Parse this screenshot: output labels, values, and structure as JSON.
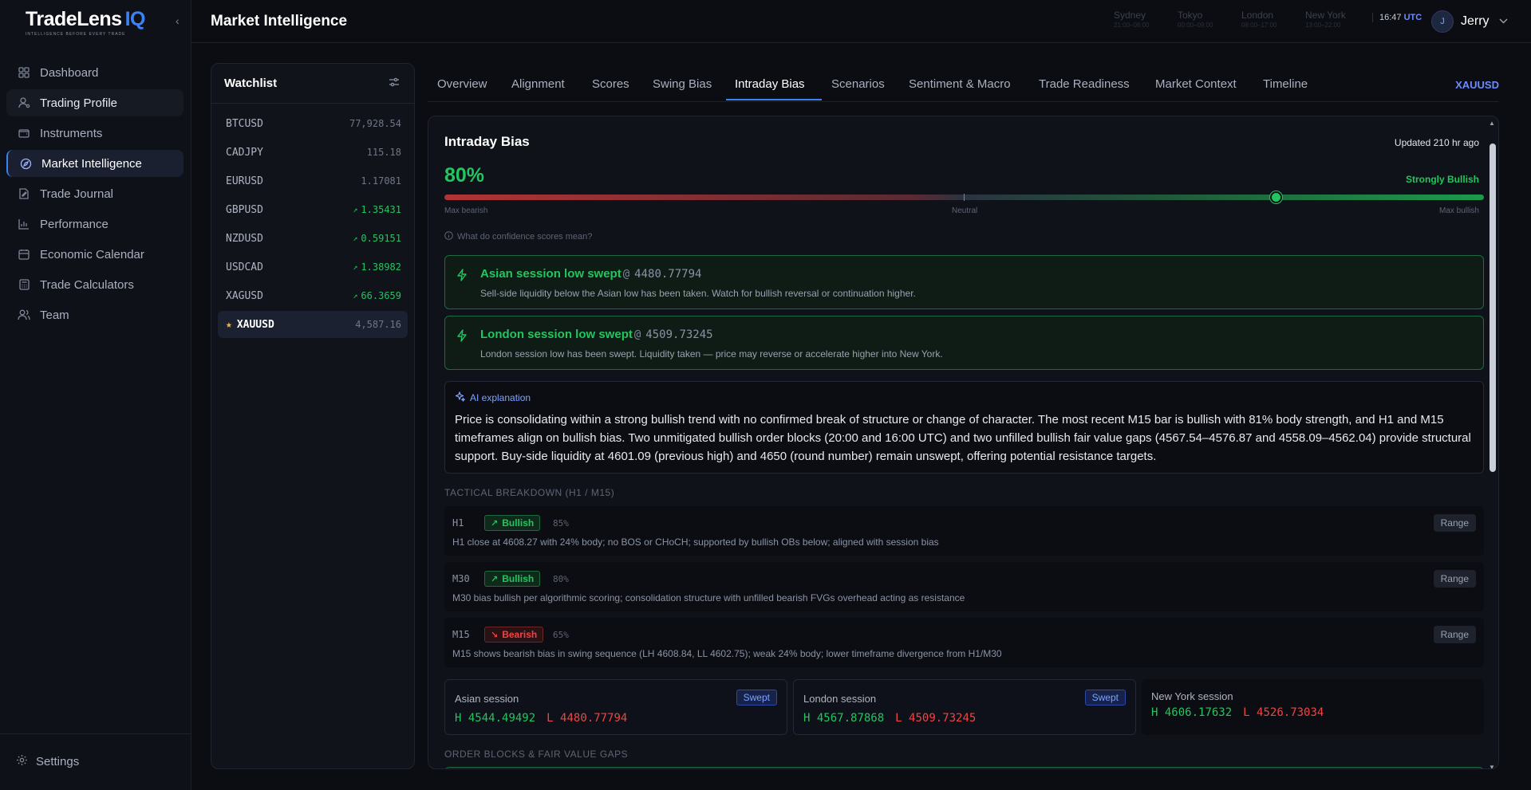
{
  "brand": {
    "name": "TradeLens",
    "suffix": "IQ",
    "tagline": "INTELLIGENCE BEFORE EVERY TRADE"
  },
  "sidebar": {
    "items": [
      {
        "label": "Dashboard",
        "icon": "grid-icon"
      },
      {
        "label": "Trading Profile",
        "icon": "user-settings-icon"
      },
      {
        "label": "Instruments",
        "icon": "wallet-icon"
      },
      {
        "label": "Market Intelligence",
        "icon": "compass-icon"
      },
      {
        "label": "Trade Journal",
        "icon": "journal-icon"
      },
      {
        "label": "Performance",
        "icon": "bar-chart-icon"
      },
      {
        "label": "Economic Calendar",
        "icon": "calendar-icon"
      },
      {
        "label": "Trade Calculators",
        "icon": "calculator-icon"
      },
      {
        "label": "Team",
        "icon": "team-icon"
      }
    ],
    "settings_label": "Settings"
  },
  "header": {
    "title": "Market Intelligence",
    "sessions": [
      {
        "name": "Sydney",
        "hours": "21:00–06:00"
      },
      {
        "name": "Tokyo",
        "hours": "00:00–09:00"
      },
      {
        "name": "London",
        "hours": "08:00–17:00"
      },
      {
        "name": "New York",
        "hours": "13:00–22:00"
      }
    ],
    "clock": {
      "time": "16:47",
      "zone": "UTC"
    },
    "user": {
      "initial": "J",
      "name": "Jerry"
    }
  },
  "watchlist": {
    "title": "Watchlist",
    "items": [
      {
        "symbol": "BTCUSD",
        "price": "77,928.54",
        "trend": ""
      },
      {
        "symbol": "CADJPY",
        "price": "115.18",
        "trend": ""
      },
      {
        "symbol": "EURUSD",
        "price": "1.17081",
        "trend": ""
      },
      {
        "symbol": "GBPUSD",
        "price": "1.35431",
        "trend": "up"
      },
      {
        "symbol": "NZDUSD",
        "price": "0.59151",
        "trend": "up"
      },
      {
        "symbol": "USDCAD",
        "price": "1.38982",
        "trend": "up"
      },
      {
        "symbol": "XAGUSD",
        "price": "66.3659",
        "trend": "up"
      },
      {
        "symbol": "XAUUSD",
        "price": "4,587.16",
        "trend": "",
        "selected": true
      }
    ]
  },
  "tabs": {
    "items": [
      "Overview",
      "Alignment",
      "Scores",
      "Swing Bias",
      "Intraday Bias",
      "Scenarios",
      "Sentiment & Macro",
      "Trade Readiness",
      "Market Context",
      "Timeline"
    ],
    "active": "Intraday Bias",
    "symbol": "XAUUSD"
  },
  "intraday": {
    "title": "Intraday Bias",
    "updated": "Updated 210 hr ago",
    "confidence_label": "80%",
    "confidence_value": 0.8,
    "strength": "Strongly Bullish",
    "meter_labels": {
      "left": "Max bearish",
      "mid": "Neutral",
      "right": "Max bullish"
    },
    "help_text": "What do confidence scores mean?",
    "sweeps": [
      {
        "name": "Asian session low swept",
        "at": "@",
        "price": "4480.77794",
        "desc": "Sell-side liquidity below the Asian low has been taken. Watch for bullish reversal or continuation higher."
      },
      {
        "name": "London session low swept",
        "at": "@",
        "price": "4509.73245",
        "desc": "London session low has been swept. Liquidity taken — price may reverse or accelerate higher into New York."
      }
    ],
    "ai": {
      "label": "AI explanation",
      "text": "Price is consolidating within a strong bullish trend with no confirmed break of structure or change of character. The most recent M15 bar is bullish with 81% body strength, and H1 and M15 timeframes align on bullish bias. Two unmitigated bullish order blocks (20:00 and 16:00 UTC) and two unfilled bullish fair value gaps (4567.54–4576.87 and 4558.09–4562.04) provide structural support. Buy-side liquidity at 4601.09 (previous high) and 4650 (round number) remain unswept, offering potential resistance targets."
    },
    "tactical_label": "TACTICAL BREAKDOWN (H1 / M15)",
    "timeframes": [
      {
        "code": "H1",
        "bias": "Bullish",
        "direction": "bull",
        "conf": "85%",
        "desc": "H1 close at 4608.27 with 24% body; no BOS or CHoCH; supported by bullish OBs below; aligned with session bias",
        "range": "Range"
      },
      {
        "code": "M30",
        "bias": "Bullish",
        "direction": "bull",
        "conf": "80%",
        "desc": "M30 bias bullish per algorithmic scoring; consolidation structure with unfilled bearish FVGs overhead acting as resistance",
        "range": "Range"
      },
      {
        "code": "M15",
        "bias": "Bearish",
        "direction": "bear",
        "conf": "65%",
        "desc": "M15 shows bearish bias in swing sequence (LH 4608.84, LL 4602.75); weak 24% body; lower timeframe divergence from H1/M30",
        "range": "Range"
      }
    ],
    "sessions": [
      {
        "name": "Asian session",
        "status": "Swept",
        "h_label": "H",
        "high": "4544.49492",
        "l_label": "L",
        "low": "4480.77794"
      },
      {
        "name": "London session",
        "status": "Swept",
        "h_label": "H",
        "high": "4567.87868",
        "l_label": "L",
        "low": "4509.73245"
      },
      {
        "name": "New York session",
        "status": "",
        "h_label": "H",
        "high": "4606.17632",
        "l_label": "L",
        "low": "4526.73034"
      }
    ],
    "ob_label": "ORDER BLOCKS & FAIR VALUE GAPS"
  },
  "colors": {
    "accent": "#3b82f6",
    "bullish": "#22c55e",
    "bearish": "#ef4444",
    "background": "#0b0d12"
  }
}
